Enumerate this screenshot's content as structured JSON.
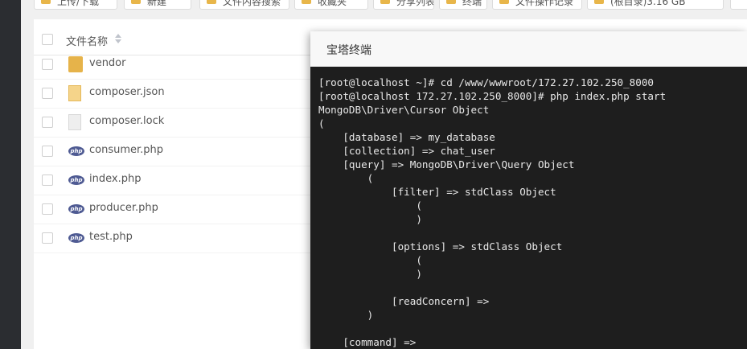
{
  "file_manager": {
    "toolbar": [
      "上传/下载",
      "新建",
      "文件内容搜索",
      "收藏夹",
      "分享列表",
      "终端",
      "文件操作记录",
      "(根目录)3.16 GB"
    ],
    "column_header": "文件名称",
    "files": [
      {
        "name": "vendor",
        "icon": "folder-icon"
      },
      {
        "name": "composer.json",
        "icon": "json-file-icon"
      },
      {
        "name": "composer.lock",
        "icon": "lock-file-icon"
      },
      {
        "name": "consumer.php",
        "icon": "php-file-icon"
      },
      {
        "name": "index.php",
        "icon": "php-file-icon"
      },
      {
        "name": "producer.php",
        "icon": "php-file-icon"
      },
      {
        "name": "test.php",
        "icon": "php-file-icon"
      }
    ]
  },
  "terminal": {
    "title": "宝塔终端",
    "output": "[root@localhost ~]# cd /www/wwwroot/172.27.102.250_8000\n[root@localhost 172.27.102.250_8000]# php index.php start\nMongoDB\\Driver\\Cursor Object\n(\n    [database] => my_database\n    [collection] => chat_user\n    [query] => MongoDB\\Driver\\Query Object\n        (\n            [filter] => stdClass Object\n                (\n                )\n\n            [options] => stdClass Object\n                (\n                )\n\n            [readConcern] =>\n        )\n\n    [command] =>",
    "background": "#1e1e1e",
    "foreground": "#e8e8e8"
  }
}
